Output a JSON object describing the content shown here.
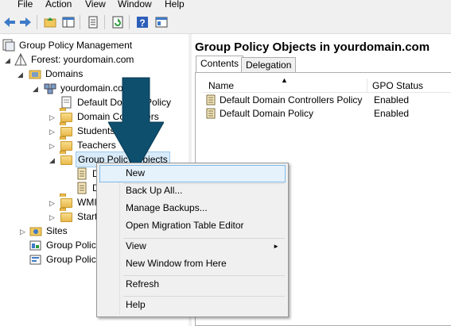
{
  "menubar": {
    "items": [
      "File",
      "Action",
      "View",
      "Window",
      "Help"
    ]
  },
  "toolbar": {
    "icons": [
      "back-icon",
      "forward-icon",
      "folder-up-icon",
      "show-hide-tree-icon",
      "properties-icon",
      "refresh-icon",
      "help-icon",
      "console-icon"
    ]
  },
  "tree": {
    "root": "Group Policy Management",
    "forest": "Forest: yourdomain.com",
    "domains": "Domains",
    "domain": "yourdomain.com",
    "ddp": "Default Domain Policy",
    "ddc": "Domain Controllers",
    "students": "Students",
    "teachers": "Teachers",
    "gpo_folder": "Group Policy Objects",
    "child1": "D",
    "child2": "D",
    "wmi": "WMI",
    "starter": "Start",
    "sites": "Sites",
    "gp_modeling": "Group Policy",
    "gp_results": "Group Policy"
  },
  "right": {
    "title": "Group Policy Objects in yourdomain.com",
    "tabs": [
      "Contents",
      "Delegation"
    ],
    "columns": [
      "Name",
      "GPO Status"
    ],
    "rows": [
      {
        "name": "Default Domain Controllers Policy",
        "status": "Enabled"
      },
      {
        "name": "Default Domain Policy",
        "status": "Enabled"
      }
    ]
  },
  "context_menu": {
    "items": [
      "New",
      "Back Up All...",
      "Manage Backups...",
      "Open Migration Table Editor",
      "View",
      "New Window from Here",
      "Refresh",
      "Help"
    ],
    "submenu_arrow": "►"
  },
  "colors": {
    "arrow": "#0e4f6e",
    "selection": "#d9ebf9",
    "menu_hover": "#e5f1fb"
  }
}
